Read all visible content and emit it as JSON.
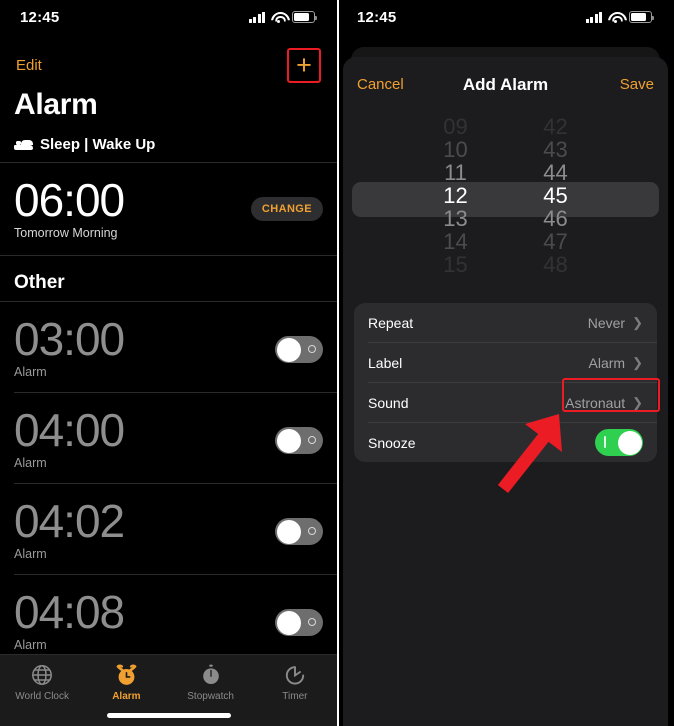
{
  "status_bar": {
    "time": "12:45",
    "signal_icon": "cellular-signal-icon",
    "wifi_icon": "wifi-icon",
    "battery_icon": "battery-icon"
  },
  "left_screen": {
    "nav": {
      "edit_label": "Edit",
      "add_icon": "plus-icon"
    },
    "page_title": "Alarm",
    "sleep_section": {
      "icon": "bed-icon",
      "label": "Sleep | Wake Up"
    },
    "sleep_alarm": {
      "time": "06:00",
      "subtitle": "Tomorrow Morning",
      "change_label": "CHANGE"
    },
    "other_section_title": "Other",
    "alarms": [
      {
        "time": "03:00",
        "label": "Alarm",
        "enabled": false
      },
      {
        "time": "04:00",
        "label": "Alarm",
        "enabled": false
      },
      {
        "time": "04:02",
        "label": "Alarm",
        "enabled": false
      },
      {
        "time": "04:08",
        "label": "Alarm",
        "enabled": false
      }
    ],
    "tabs": [
      {
        "label": "World Clock",
        "icon": "globe-icon",
        "active": false
      },
      {
        "label": "Alarm",
        "icon": "alarm-clock-icon",
        "active": true
      },
      {
        "label": "Stopwatch",
        "icon": "stopwatch-icon",
        "active": false
      },
      {
        "label": "Timer",
        "icon": "timer-icon",
        "active": false
      }
    ]
  },
  "right_screen": {
    "sheet_nav": {
      "cancel_label": "Cancel",
      "title": "Add Alarm",
      "save_label": "Save"
    },
    "picker": {
      "hours": [
        "09",
        "10",
        "11",
        "12",
        "13",
        "14",
        "15"
      ],
      "minutes": [
        "42",
        "43",
        "44",
        "45",
        "46",
        "47",
        "48"
      ],
      "selected_hour": "12",
      "selected_minute": "45"
    },
    "options": [
      {
        "label": "Repeat",
        "value": "Never",
        "type": "disclosure",
        "highlighted": false
      },
      {
        "label": "Label",
        "value": "Alarm",
        "type": "disclosure",
        "highlighted": false
      },
      {
        "label": "Sound",
        "value": "Astronaut",
        "type": "disclosure",
        "highlighted": true
      },
      {
        "label": "Snooze",
        "value": "On",
        "type": "toggle",
        "highlighted": false
      }
    ],
    "annotation": {
      "arrow_icon": "red-arrow-pointing-up-right",
      "highlight_color": "#ec1c24"
    }
  },
  "colors": {
    "accent_orange": "#f0a030",
    "highlight_red": "#ec1c24",
    "toggle_on_green": "#2fd04f",
    "sheet_bg": "#1c1c1e",
    "card_bg": "#2c2c2e"
  }
}
